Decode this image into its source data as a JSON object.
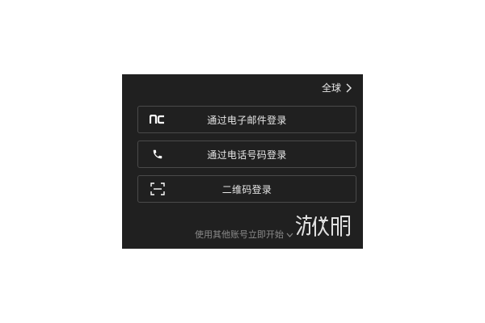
{
  "region": {
    "label": "全球"
  },
  "login_options": [
    {
      "label": "通过电子邮件登录",
      "icon": "nc-logo-icon"
    },
    {
      "label": "通过电话号码登录",
      "icon": "phone-icon"
    },
    {
      "label": "二维码登录",
      "icon": "qr-scan-icon"
    }
  ],
  "other_accounts": {
    "label": "使用其他账号立即开始"
  },
  "watermark": {
    "text": "游侠网"
  },
  "colors": {
    "panel_bg": "#202020",
    "button_border": "#4a4a4a",
    "text_primary": "#e6e6e6",
    "text_muted": "#8a8a8a"
  }
}
